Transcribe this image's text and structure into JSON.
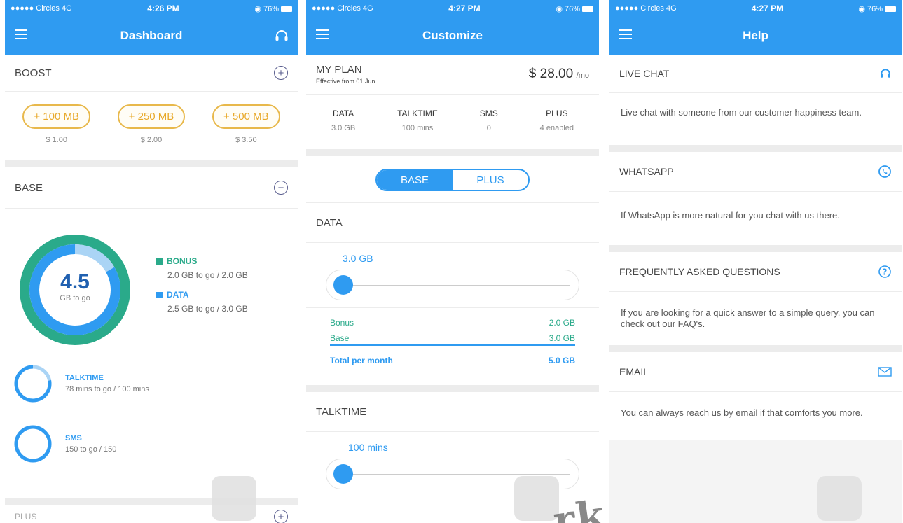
{
  "status": {
    "carrier": "●●●●● Circles  4G",
    "battery": "◉ 76%",
    "times": [
      "4:26 PM",
      "4:27 PM",
      "4:27 PM"
    ]
  },
  "dashboard": {
    "title": "Dashboard",
    "boost": {
      "label": "BOOST",
      "options": [
        {
          "amount": "+ 100 MB",
          "price": "$ 1.00"
        },
        {
          "amount": "+ 250 MB",
          "price": "$ 2.00"
        },
        {
          "amount": "+ 500 MB",
          "price": "$ 3.50"
        }
      ]
    },
    "base": {
      "label": "BASE",
      "total": "4.5",
      "total_unit": "GB to go",
      "bonus": {
        "label": "BONUS",
        "value": "2.0 GB to go / 2.0 GB",
        "fraction": 1.0
      },
      "data": {
        "label": "DATA",
        "value": "2.5 GB to go / 3.0 GB",
        "fraction": 0.833
      },
      "talktime": {
        "label": "TALKTIME",
        "value": "78 mins to go / 100 mins",
        "fraction": 0.78
      },
      "sms": {
        "label": "SMS",
        "value": "150 to go / 150",
        "fraction": 1.0
      },
      "plus_label": "PLUS"
    }
  },
  "customize": {
    "title": "Customize",
    "plan": {
      "label": "MY PLAN",
      "effective": "Effective from 01 Jun",
      "price": "$ 28.00",
      "per": "/mo"
    },
    "stats": [
      {
        "key": "DATA",
        "value": "3.0 GB"
      },
      {
        "key": "TALKTIME",
        "value": "100 mins"
      },
      {
        "key": "SMS",
        "value": "0"
      },
      {
        "key": "PLUS",
        "value": "4 enabled"
      }
    ],
    "toggle": {
      "left": "BASE",
      "right": "PLUS"
    },
    "data": {
      "label": "DATA",
      "value": "3.0 GB",
      "level": 0.0,
      "breakdown": [
        {
          "name": "Bonus",
          "value": "2.0 GB"
        },
        {
          "name": "Base",
          "value": "3.0 GB"
        }
      ],
      "total_label": "Total per month",
      "total_value": "5.0 GB"
    },
    "talktime": {
      "label": "TALKTIME",
      "value": "100 mins",
      "level": 0.0
    }
  },
  "help": {
    "title": "Help",
    "items": [
      {
        "label": "LIVE CHAT",
        "icon": "headset-icon",
        "desc": "Live chat with someone from our customer happiness team."
      },
      {
        "label": "WHATSAPP",
        "icon": "whatsapp-icon",
        "desc": "If WhatsApp is more natural for you chat with us there."
      },
      {
        "label": "FREQUENTLY ASKED QUESTIONS",
        "icon": "question-icon",
        "desc": "If you are looking for a quick answer to a simple query, you can check out our FAQ's."
      },
      {
        "label": "EMAIL",
        "icon": "mail-icon",
        "desc": "You can always reach us by email if that comforts you more."
      }
    ]
  },
  "colors": {
    "primary": "#2f9bf1",
    "bonus": "#2aaa8a",
    "boost": "#e8b84a"
  },
  "watermark_text": "rk"
}
